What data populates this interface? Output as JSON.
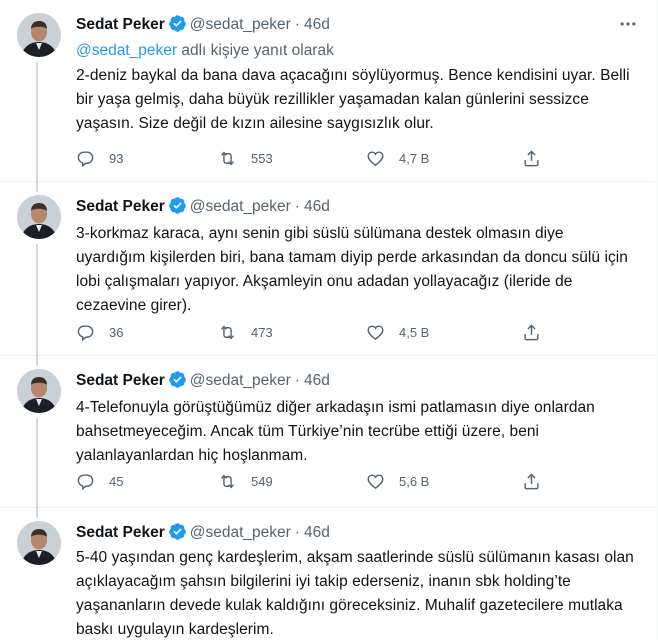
{
  "user": {
    "name": "Sedat Peker",
    "handle": "@sedat_peker",
    "separator": "·"
  },
  "colors": {
    "accent": "#1d9bf0",
    "muted": "#536471",
    "text": "#0f1419",
    "border": "#eff3f4"
  },
  "tweets": [
    {
      "time": "46d",
      "reply_prefix_mention": "@sedat_peker",
      "reply_suffix": " adlı kişiye yanıt olarak",
      "text": "2-deniz baykal da bana dava açacağını söylüyormuş. Bence kendisini uyar. Belli bir yaşa gelmiş, daha büyük rezillikler yaşamadan kalan günlerini sessizce yaşasın. Size değil de kızın ailesine saygısızlık olur.",
      "replies": "93",
      "retweets": "553",
      "likes": "4,7 B"
    },
    {
      "time": "46d",
      "text": "3-korkmaz karaca, aynı senin gibi süslü sülümana destek olmasın diye uyardığım kişilerden biri, bana tamam diyip perde arkasından da doncu sülü için lobi çalışmaları yapıyor. Akşamleyin onu adadan yollayacağız (ileride de cezaevine girer).",
      "replies": "36",
      "retweets": "473",
      "likes": "4,5 B"
    },
    {
      "time": "46d",
      "text": "4-Telefonuyla görüştüğümüz diğer arkadaşın ismi patlamasın diye onlardan bahsetmeyeceğim. Ancak tüm Türkiye’nin tecrübe ettiği üzere, beni yalanlayanlardan hiç hoşlanmam.",
      "replies": "45",
      "retweets": "549",
      "likes": "5,6 B"
    },
    {
      "time": "46d",
      "text": "5-40 yaşından genç kardeşlerim, akşam saatlerinde süslü sülümanın kasası olan açıklayacağım şahsın bilgilerini iyi takip ederseniz, inanın sbk holding’te yaşananların devede kulak kaldığını göreceksiniz. Muhalif gazetecilere mutlaka baskı uygulayın kardeşlerim."
    }
  ],
  "icons": {
    "verified": "verified-badge-icon",
    "more": "more-icon",
    "reply": "reply-icon",
    "retweet": "retweet-icon",
    "like": "heart-icon",
    "share": "share-icon"
  }
}
